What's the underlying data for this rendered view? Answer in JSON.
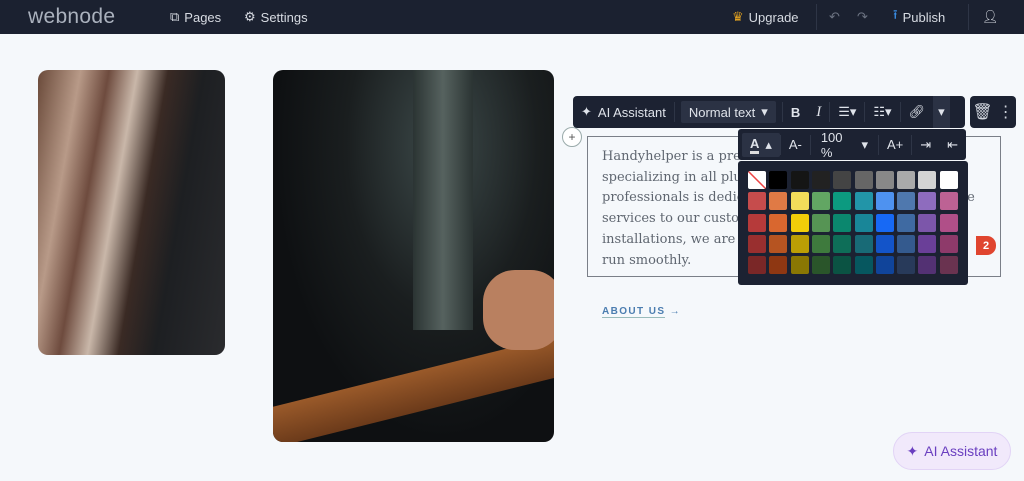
{
  "topbar": {
    "logo": "webnode",
    "pages": "Pages",
    "settings": "Settings",
    "upgrade": "Upgrade",
    "publish": "Publish"
  },
  "toolbar": {
    "ai": "AI Assistant",
    "style": "Normal text",
    "bold": "B",
    "italic": "I"
  },
  "subtoolbar": {
    "text_color": "A",
    "decrease": "A-",
    "zoom": "100 %",
    "increase": "A+"
  },
  "palette": [
    [
      "none",
      "#000000",
      "#151515",
      "#222222",
      "#444444",
      "#666666",
      "#888888",
      "#aaaaaa",
      "#d4d4d4",
      "#ffffff"
    ],
    [
      "#c64c4c",
      "#e07a45",
      "#f2dc5a",
      "#62a663",
      "#0c9a80",
      "#2295a8",
      "#4e92f0",
      "#4f78ae",
      "#8e6cbe",
      "#bd6294"
    ],
    [
      "#b63a3a",
      "#d9672f",
      "#f2cd09",
      "#569454",
      "#0b876e",
      "#198698",
      "#1769f5",
      "#3f6aa2",
      "#7c56aa",
      "#b04f88"
    ],
    [
      "#992f2f",
      "#b65421",
      "#bb9e05",
      "#3e7a3d",
      "#0e6e58",
      "#186a76",
      "#1354c9",
      "#345a8e",
      "#6a3f98",
      "#8e3a6a"
    ],
    [
      "#7a2727",
      "#8e3712",
      "#8a7703",
      "#2a552a",
      "#0b5343",
      "#06575f",
      "#10449a",
      "#283a5a",
      "#533173",
      "#6a3350"
    ]
  ],
  "content": {
    "lines": [
      "Handyhelper is a prem",
      "specializing in all plum",
      "professionals is dedicat",
      "services to our custome",
      "installations, we are he",
      "run smoothly."
    ],
    "line3_tail": "le",
    "badge": "2",
    "about": "ABOUT US",
    "about_arrow": "→"
  },
  "ai_button": "AI Assistant"
}
